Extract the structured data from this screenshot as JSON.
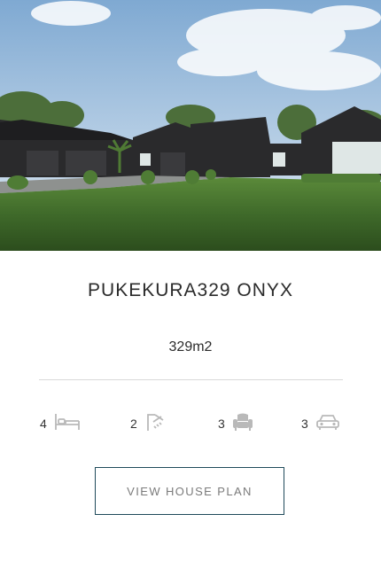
{
  "listing": {
    "title": "PUKEKURA329 ONYX",
    "area": "329m2",
    "features": [
      {
        "value": "4",
        "icon": "bed-icon"
      },
      {
        "value": "2",
        "icon": "bath-icon"
      },
      {
        "value": "3",
        "icon": "armchair-icon"
      },
      {
        "value": "3",
        "icon": "car-icon"
      }
    ],
    "cta_label": "VIEW HOUSE PLAN"
  },
  "colors": {
    "sky_top": "#7fa9d2",
    "house": "#2a2a2c",
    "lawn": "#3f6a2a",
    "button_border": "#1f4a5a",
    "icon_gray": "#b9b9b9"
  }
}
